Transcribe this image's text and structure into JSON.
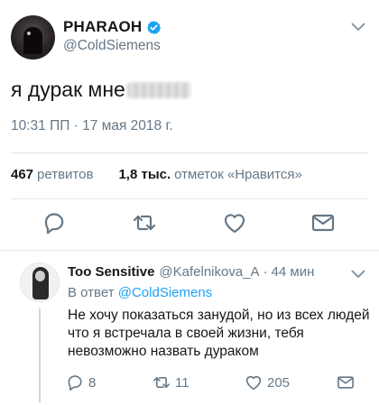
{
  "tweet": {
    "author_name": "PHARAOH",
    "author_handle": "@ColdSiemens",
    "text": "я дурак мне",
    "timestamp": "10:31 ПП · 17 мая 2018 г.",
    "retweets_count": "467",
    "retweets_label": "ретвитов",
    "likes_count": "1,8 тыс.",
    "likes_label": "отметок «Нравится»"
  },
  "reply": {
    "author_name": "Too Sensitive",
    "author_handle": "@Kafelnikova_A",
    "dot": "·",
    "time": "44 мин",
    "reply_to_prefix": "В ответ",
    "reply_to_handle": "@ColdSiemens",
    "text": "Не хочу показаться занудой, но из всех людей что я встречала в своей жизни, тебя невозможно назвать дураком",
    "reply_count": "8",
    "retweet_count": "11",
    "like_count": "205"
  },
  "colors": {
    "accent": "#1da1f2",
    "icon_gray": "#657786",
    "divider": "#e1e8ed"
  },
  "icons": [
    "verified-badge-icon",
    "chevron-down-icon",
    "reply-icon",
    "retweet-icon",
    "like-heart-icon",
    "direct-message-icon"
  ]
}
